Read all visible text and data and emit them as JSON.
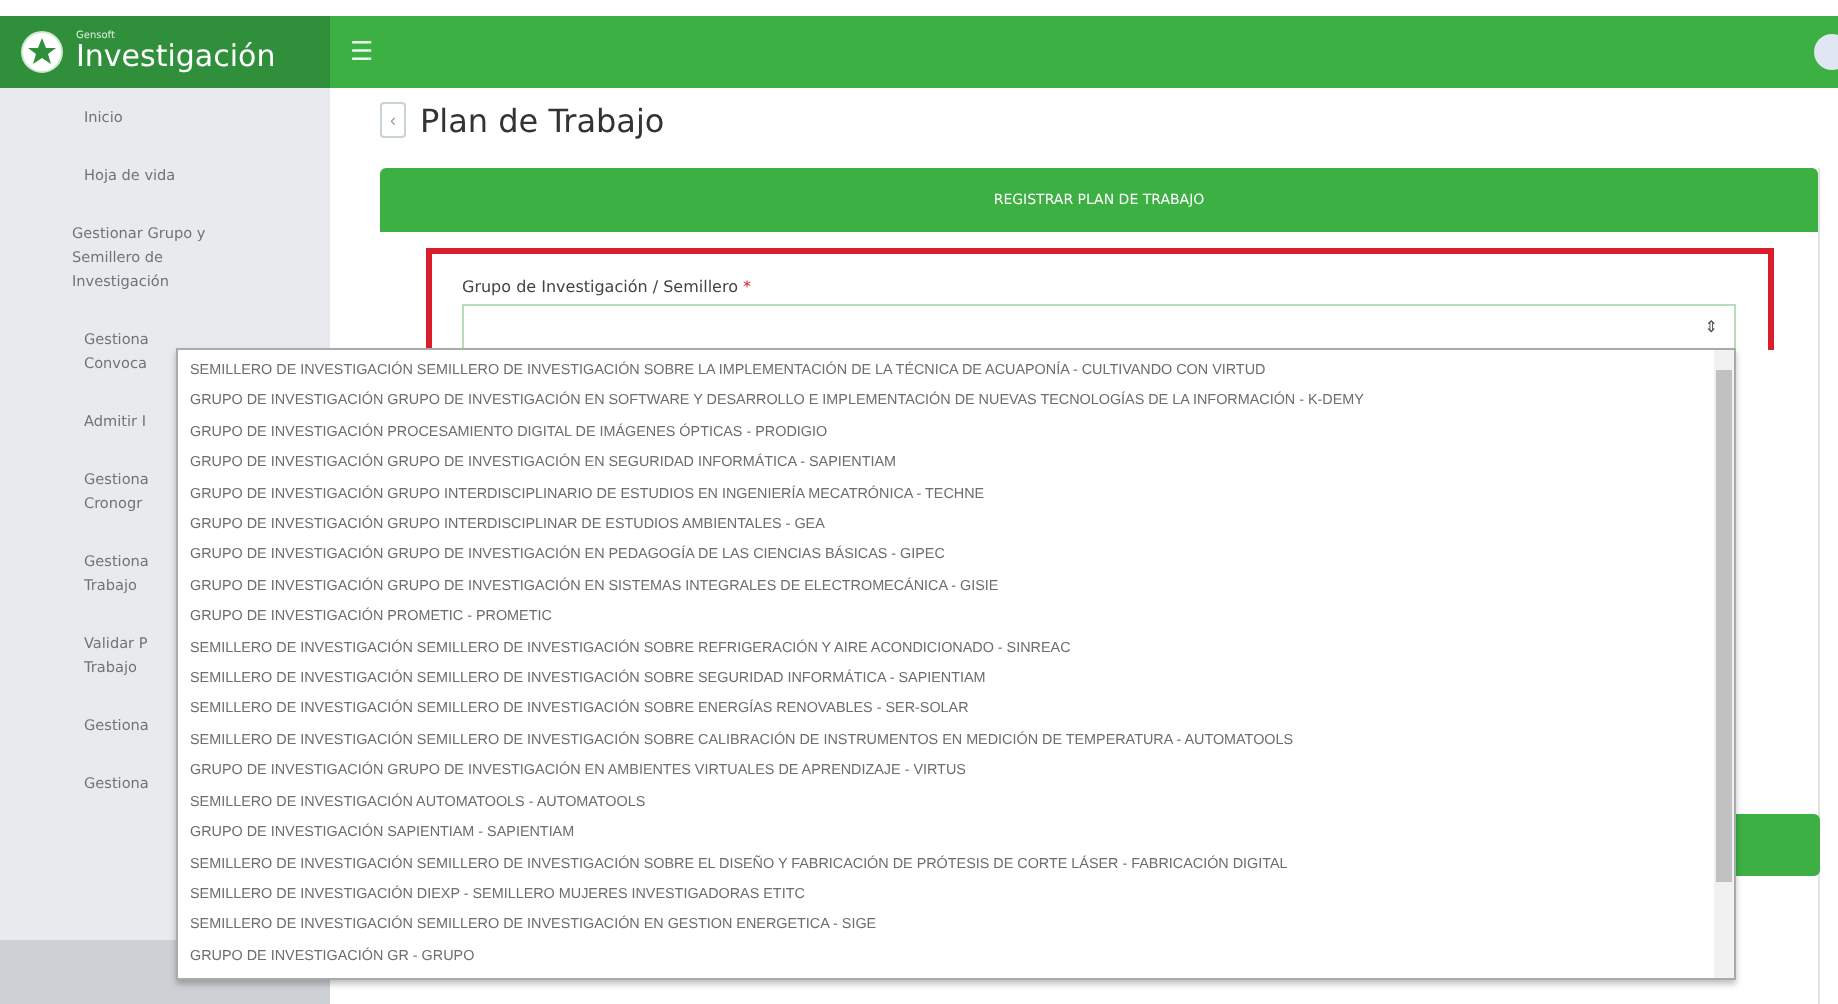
{
  "header": {
    "brand_small": "Gensoft",
    "brand": "Investigación",
    "menu_icon": "☰"
  },
  "sidebar": {
    "items": [
      {
        "lines": [
          "Inicio"
        ]
      },
      {
        "lines": [
          "Hoja de vida"
        ]
      },
      {
        "lines": [
          "Gestionar Grupo y",
          "Semillero de",
          "Investigación"
        ]
      },
      {
        "lines": [
          "Gestiona",
          "Convoca"
        ]
      },
      {
        "lines": [
          "Admitir I"
        ]
      },
      {
        "lines": [
          "Gestiona",
          "Cronogr"
        ]
      },
      {
        "lines": [
          "Gestiona",
          "Trabajo"
        ]
      },
      {
        "lines": [
          "Validar P",
          "Trabajo"
        ]
      },
      {
        "lines": [
          "Gestiona"
        ]
      },
      {
        "lines": [
          "Gestiona"
        ]
      }
    ]
  },
  "page": {
    "back": "‹",
    "title": "Plan de Trabajo"
  },
  "form": {
    "header": "REGISTRAR PLAN DE TRABAJO",
    "field": {
      "label": "Grupo de Investigación / Semillero",
      "required_mark": "*",
      "highlighted": true,
      "expanded": true,
      "arrows": "⇕"
    }
  },
  "dropdown": {
    "options": [
      "SEMILLERO DE INVESTIGACIÓN SEMILLERO DE INVESTIGACIÓN SOBRE LA IMPLEMENTACIÓN DE LA TÉCNICA DE ACUAPONÍA - CULTIVANDO CON VIRTUD",
      "GRUPO DE INVESTIGACIÓN GRUPO DE INVESTIGACIÓN EN SOFTWARE Y DESARROLLO E IMPLEMENTACIÓN DE NUEVAS TECNOLOGÍAS DE LA INFORMACIÓN - K-DEMY",
      "GRUPO DE INVESTIGACIÓN PROCESAMIENTO DIGITAL DE IMÁGENES ÓPTICAS - PRODIGIO",
      "GRUPO DE INVESTIGACIÓN GRUPO DE INVESTIGACIÓN EN SEGURIDAD INFORMÁTICA - SAPIENTIAM",
      "GRUPO DE INVESTIGACIÓN GRUPO INTERDISCIPLINARIO DE ESTUDIOS EN INGENIERÍA MECATRÓNICA - TECHNE",
      "GRUPO DE INVESTIGACIÓN GRUPO INTERDISCIPLINAR DE ESTUDIOS AMBIENTALES - GEA",
      "GRUPO DE INVESTIGACIÓN GRUPO DE INVESTIGACIÓN EN PEDAGOGÍA DE LAS CIENCIAS BÁSICAS - GIPEC",
      "GRUPO DE INVESTIGACIÓN GRUPO DE INVESTIGACIÓN EN SISTEMAS INTEGRALES DE ELECTROMECÁNICA - GISIE",
      "GRUPO DE INVESTIGACIÓN PROMETIC - PROMETIC",
      "SEMILLERO DE INVESTIGACIÓN SEMILLERO DE INVESTIGACIÓN SOBRE REFRIGERACIÓN Y AIRE ACONDICIONADO - SINREAC",
      "SEMILLERO DE INVESTIGACIÓN SEMILLERO DE INVESTIGACIÓN SOBRE SEGURIDAD INFORMÁTICA - SAPIENTIAM",
      "SEMILLERO DE INVESTIGACIÓN SEMILLERO DE INVESTIGACIÓN SOBRE ENERGÍAS RENOVABLES - SER-SOLAR",
      "SEMILLERO DE INVESTIGACIÓN SEMILLERO DE INVESTIGACIÓN SOBRE CALIBRACIÓN DE INSTRUMENTOS EN MEDICIÓN DE TEMPERATURA - AUTOMATOOLS",
      "GRUPO DE INVESTIGACIÓN GRUPO DE INVESTIGACIÓN EN AMBIENTES VIRTUALES DE APRENDIZAJE - VIRTUS",
      "SEMILLERO DE INVESTIGACIÓN AUTOMATOOLS - AUTOMATOOLS",
      "GRUPO DE INVESTIGACIÓN SAPIENTIAM - SAPIENTIAM",
      "SEMILLERO DE INVESTIGACIÓN SEMILLERO DE INVESTIGACIÓN SOBRE EL DISEÑO Y FABRICACIÓN DE PRÓTESIS DE CORTE LÁSER - FABRICACIÓN DIGITAL",
      "SEMILLERO DE INVESTIGACIÓN DIEXP - SEMILLERO MUJERES INVESTIGADORAS ETITC",
      "SEMILLERO DE INVESTIGACIÓN SEMILLERO DE INVESTIGACIÓN EN GESTION ENERGETICA - SIGE",
      "GRUPO DE INVESTIGACIÓN GR - GRUPO"
    ]
  }
}
